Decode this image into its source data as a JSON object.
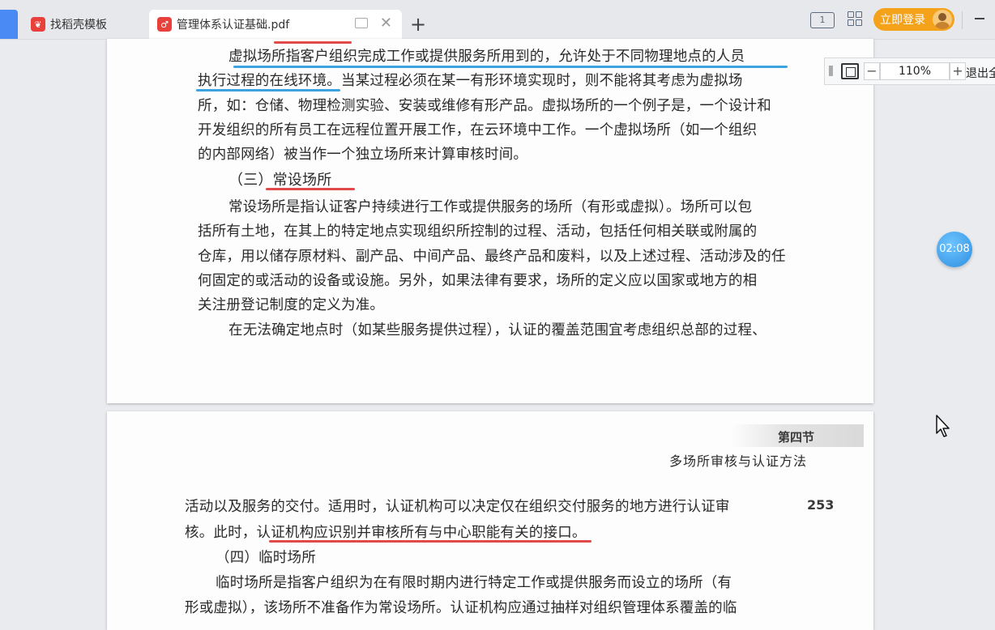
{
  "tabs": [
    {
      "label": "找稻壳模板"
    },
    {
      "label": "管理体系认证基础.pdf"
    }
  ],
  "toolbar": {
    "read_mode_label": "1",
    "login_label": "立即登录"
  },
  "zoom": {
    "value": "110%",
    "minus": "−",
    "plus": "+",
    "exit_label": "退出全"
  },
  "timer": "02:08",
  "page1": {
    "lines": [
      "虚拟场所指客户组织完成工作或提供服务所用到的，允许处于不同物理地点的人员",
      "执行过程的在线环境。当某过程必须在某一有形环境实现时，则不能将其考虑为虚拟场",
      "所，如：仓储、物理检测实验、安装或维修有形产品。虚拟场所的一个例子是，一个设计和",
      "开发组织的所有员工在远程位置开展工作，在云环境中工作。一个虚拟场所（如一个组织",
      "的内部网络）被当作一个独立场所来计算审核时间。",
      "（三）常设场所",
      "常设场所是指认证客户持续进行工作或提供服务的场所（有形或虚拟）。场所可以包",
      "括所有土地，在其上的特定地点实现组织所控制的过程、活动，包括任何相关联或附属的",
      "仓库，用以储存原材料、副产品、中间产品、最终产品和废料，以及上述过程、活动涉及的任",
      "何固定的或活动的设备或设施。另外，如果法律有要求，场所的定义应以国家或地方的相",
      "关注册登记制度的定义为准。",
      "在无法确定地点时（如某些服务提供过程），认证的覆盖范围宜考虑组织总部的过程、"
    ]
  },
  "page2": {
    "section_label": "第四节",
    "section_title": "多场所审核与认证方法",
    "page_number": "253",
    "lines": [
      "活动以及服务的交付。适用时，认证机构可以决定仅在组织交付服务的地方进行认证审",
      "核。此时，认证机构应识别并审核所有与中心职能有关的接口。",
      "（四）临时场所",
      "临时场所是指客户组织为在有限时期内进行特定工作或提供服务而设立的场所（有",
      "形或虚拟），该场所不准备作为常设场所。认证机构应通过抽样对组织管理体系覆盖的临"
    ]
  },
  "colors": {
    "accent": "#4a8af4",
    "login": "#f3a21a",
    "underline_red": "#e14a4a",
    "underline_blue": "#3aa3e0"
  }
}
